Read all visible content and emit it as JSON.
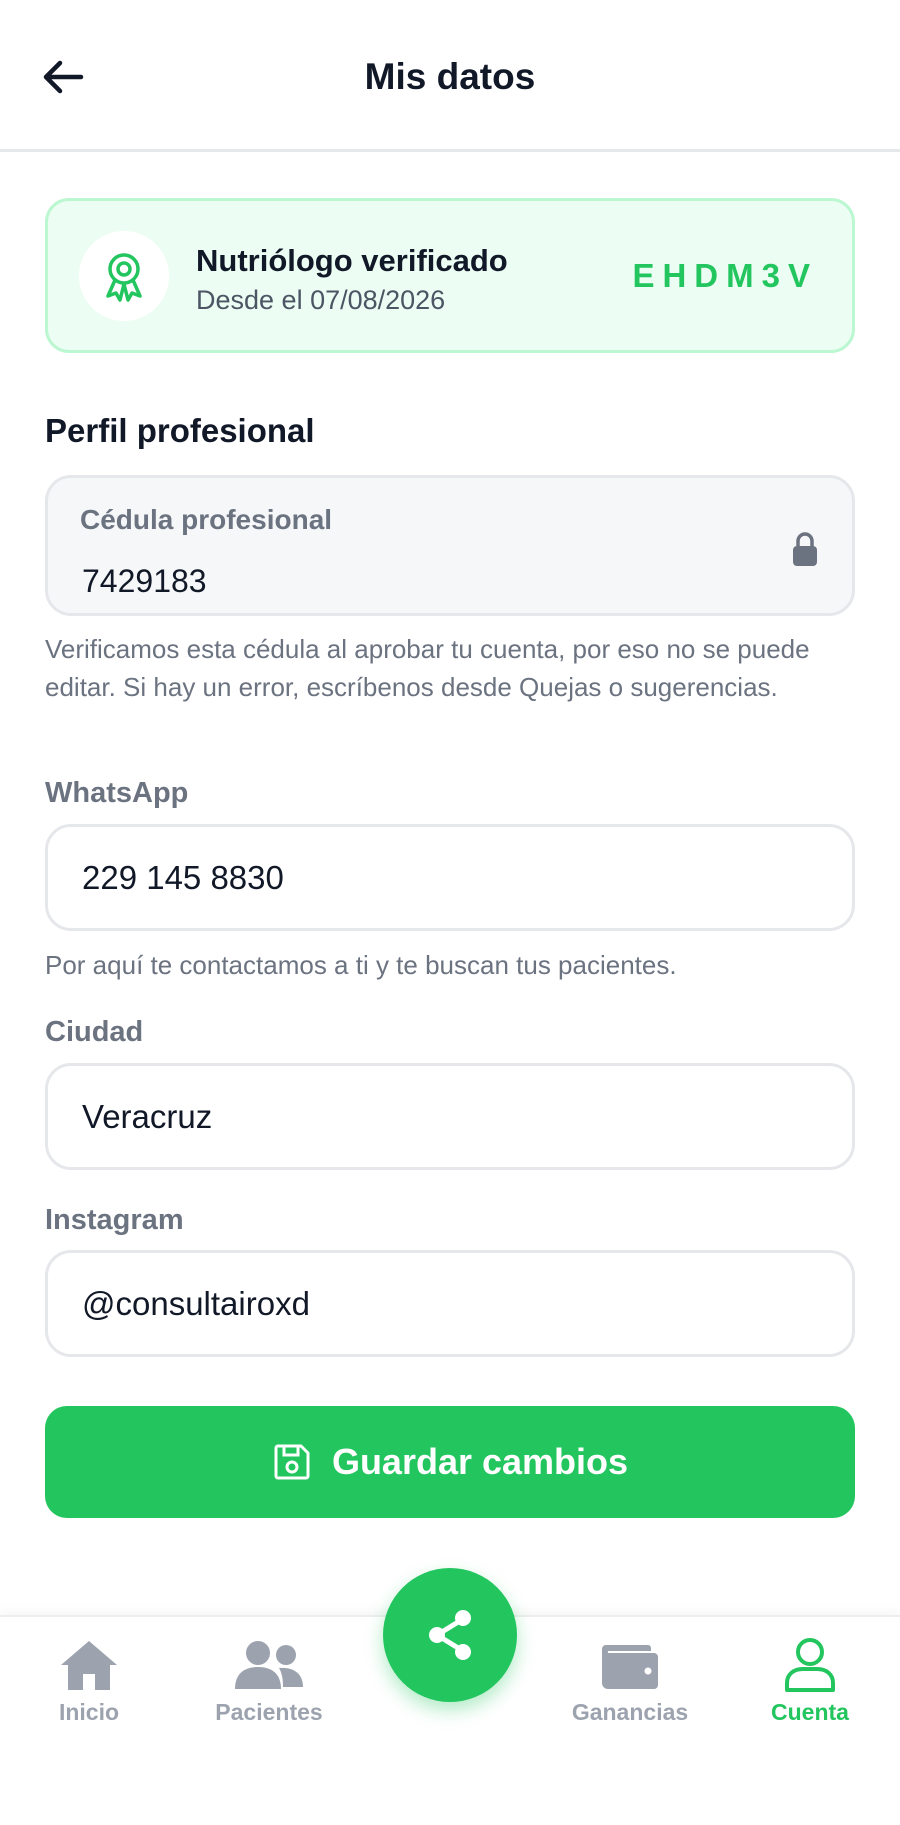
{
  "header": {
    "title": "Mis datos",
    "back_icon": "arrow-left-icon"
  },
  "verified": {
    "title": "Nutriólogo verificado",
    "since": "Desde el 07/08/2026",
    "code": "EHDM3V",
    "icon": "award-badge-icon"
  },
  "profile": {
    "section_title": "Perfil profesional",
    "cedula": {
      "label": "Cédula profesional",
      "value": "7429183",
      "icon": "lock-icon",
      "helper": "Verificamos esta cédula al aprobar tu cuenta, por eso no se puede editar. Si hay un error, escríbenos desde Quejas o sugerencias."
    },
    "whatsapp": {
      "label": "WhatsApp",
      "value": "229 145 8830",
      "helper": "Por aquí te contactamos a ti y te buscan tus pacientes."
    },
    "ciudad": {
      "label": "Ciudad",
      "value": "Veracruz"
    },
    "instagram": {
      "label": "Instagram",
      "value": "@consultairoxd"
    }
  },
  "actions": {
    "save_label": "Guardar cambios",
    "save_icon": "floppy-disk-icon"
  },
  "nav": {
    "items": [
      {
        "label": "Inicio",
        "icon": "home-icon"
      },
      {
        "label": "Pacientes",
        "icon": "users-icon"
      },
      {
        "label": "Ganancias",
        "icon": "wallet-icon"
      },
      {
        "label": "Cuenta",
        "icon": "user-icon"
      }
    ],
    "active": "Cuenta",
    "fab_icon": "share-icon"
  },
  "colors": {
    "accent": "#22c55e",
    "accent_bg": "#ecfdf3",
    "muted": "#6b7280",
    "inactive": "#9ca3af"
  }
}
